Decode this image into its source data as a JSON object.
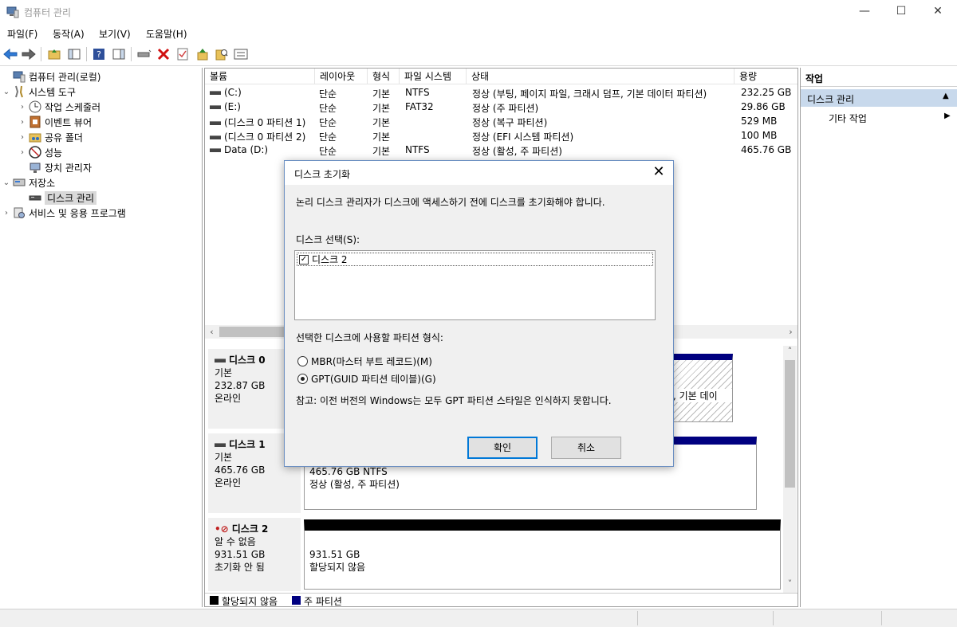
{
  "window": {
    "title": "컴퓨터 관리",
    "minimize": "—",
    "maximize": "☐",
    "close": "✕"
  },
  "menu": [
    "파일(F)",
    "동작(A)",
    "보기(V)",
    "도움말(H)"
  ],
  "tree": {
    "root": "컴퓨터 관리(로컬)",
    "system_tools": "시스템 도구",
    "task_scheduler": "작업 스케줄러",
    "event_viewer": "이벤트 뷰어",
    "shared_folders": "공유 폴더",
    "performance": "성능",
    "device_manager": "장치 관리자",
    "storage": "저장소",
    "disk_management": "디스크 관리",
    "services": "서비스 및 응용 프로그램"
  },
  "volumes": {
    "columns": [
      "볼륨",
      "레이아웃",
      "형식",
      "파일 시스템",
      "상태",
      "용량"
    ],
    "rows": [
      {
        "volume": "(C:)",
        "layout": "단순",
        "type": "기본",
        "fs": "NTFS",
        "status": "정상 (부팅, 페이지 파일, 크래시 덤프, 기본 데이터 파티션)",
        "capacity": "232.25 GB"
      },
      {
        "volume": "(E:)",
        "layout": "단순",
        "type": "기본",
        "fs": "FAT32",
        "status": "정상 (주 파티션)",
        "capacity": "29.86 GB"
      },
      {
        "volume": "(디스크 0 파티션 1)",
        "layout": "단순",
        "type": "기본",
        "fs": "",
        "status": "정상 (복구 파티션)",
        "capacity": "529 MB"
      },
      {
        "volume": "(디스크 0 파티션 2)",
        "layout": "단순",
        "type": "기본",
        "fs": "",
        "status": "정상 (EFI 시스템 파티션)",
        "capacity": "100 MB"
      },
      {
        "volume": "Data (D:)",
        "layout": "단순",
        "type": "기본",
        "fs": "NTFS",
        "status": "정상 (활성, 주 파티션)",
        "capacity": "465.76 GB"
      }
    ]
  },
  "disks": {
    "disk0": {
      "name": "디스크 0",
      "kind": "기본",
      "size": "232.87 GB",
      "state": "온라인",
      "partition_tail": ", 기본 데이"
    },
    "disk1": {
      "name": "디스크 1",
      "kind": "기본",
      "size": "465.76 GB",
      "state": "온라인",
      "part_size": "465.76 GB NTFS",
      "part_status": "정상 (활성, 주 파티션)"
    },
    "disk2": {
      "name": "디스크 2",
      "kind": "알 수 없음",
      "size": "931.51 GB",
      "state": "초기화 안 됨",
      "part_size": "931.51 GB",
      "part_status": "할당되지 않음"
    }
  },
  "legend": {
    "unallocated": "할당되지 않음",
    "primary": "주 파티션",
    "unallocated_color": "#000000",
    "primary_color": "#000080"
  },
  "actions": {
    "header": "작업",
    "section": "디스크 관리",
    "other": "기타 작업"
  },
  "dialog": {
    "title": "디스크 초기화",
    "message": "논리 디스크 관리자가 디스크에 액세스하기 전에 디스크를 초기화해야 합니다.",
    "select_label": "디스크 선택(S):",
    "disk_item": "디스크 2",
    "style_label": "선택한 디스크에 사용할 파티션 형식:",
    "mbr_label": "MBR(마스터 부트 레코드)(M)",
    "gpt_label": "GPT(GUID 파티션 테이블)(G)",
    "note": "참고: 이전 버전의 Windows는 모두 GPT 파티션 스타일은 인식하지 못합니다.",
    "ok": "확인",
    "cancel": "취소",
    "selected_style": "GPT"
  }
}
